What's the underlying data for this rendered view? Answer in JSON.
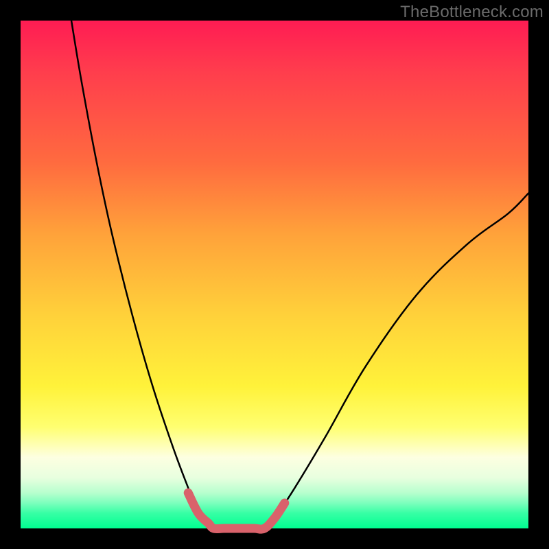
{
  "watermark": "TheBottleneck.com",
  "chart_data": {
    "type": "line",
    "title": "",
    "xlabel": "",
    "ylabel": "",
    "xlim": [
      0,
      100
    ],
    "ylim": [
      0,
      100
    ],
    "grid": false,
    "series": [
      {
        "name": "black-curve-left",
        "color": "#000000",
        "x": [
          10,
          12,
          15,
          18,
          22,
          26,
          30,
          33,
          35,
          37,
          38
        ],
        "y": [
          100,
          88,
          72,
          58,
          42,
          28,
          16,
          8,
          3,
          1,
          0
        ]
      },
      {
        "name": "black-curve-right",
        "color": "#000000",
        "x": [
          48,
          50,
          54,
          60,
          68,
          78,
          88,
          96,
          100
        ],
        "y": [
          0,
          2,
          8,
          18,
          32,
          46,
          56,
          62,
          66
        ]
      },
      {
        "name": "red-trough-overlay",
        "color": "#d9626b",
        "x": [
          33,
          35,
          37,
          38,
          40,
          43,
          46,
          48,
          50,
          52
        ],
        "y": [
          7,
          3,
          1,
          0,
          0,
          0,
          0,
          0,
          2,
          5
        ]
      }
    ],
    "annotations": []
  }
}
